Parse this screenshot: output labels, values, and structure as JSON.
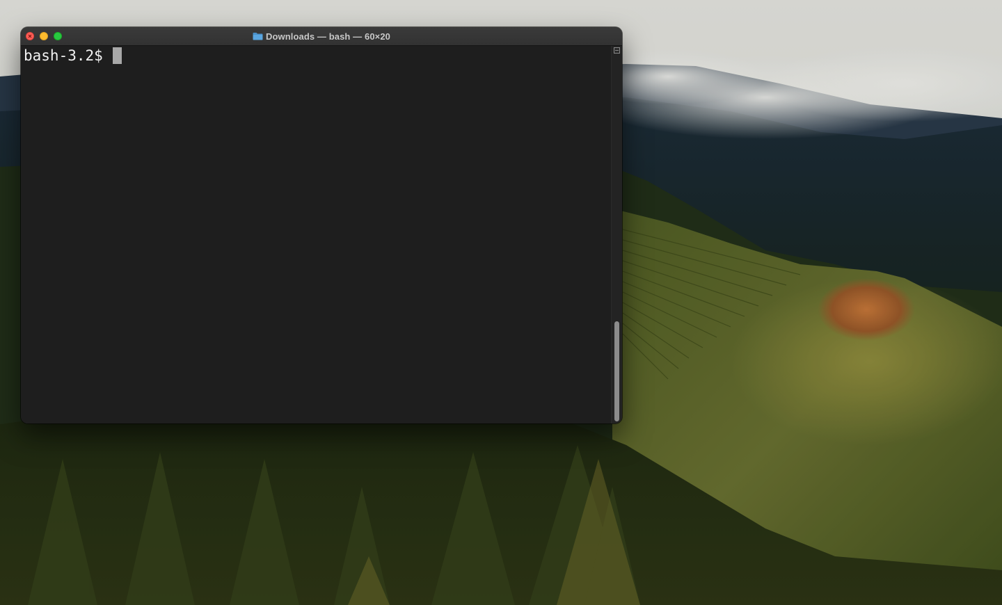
{
  "window": {
    "title": "Downloads — bash — 60×20",
    "title_icon": "folder-icon",
    "traffic_lights": {
      "close": {
        "icon": "close-icon",
        "color": "#fe5f57"
      },
      "minimize": {
        "icon": "minimize-icon",
        "color": "#febc2e"
      },
      "zoom": {
        "icon": "zoom-icon",
        "color": "#28c840"
      }
    }
  },
  "terminal": {
    "prompt": "bash-3.2$ ",
    "background": "#1e1e1e",
    "text_color": "#f2f2f2",
    "cursor_color": "#a8a8a8"
  },
  "scrollbar": {
    "split_icon": "split-pane-icon",
    "thumb_color": "#8c8c8c"
  },
  "desktop": {
    "wallpaper": "misty hills landscape"
  }
}
